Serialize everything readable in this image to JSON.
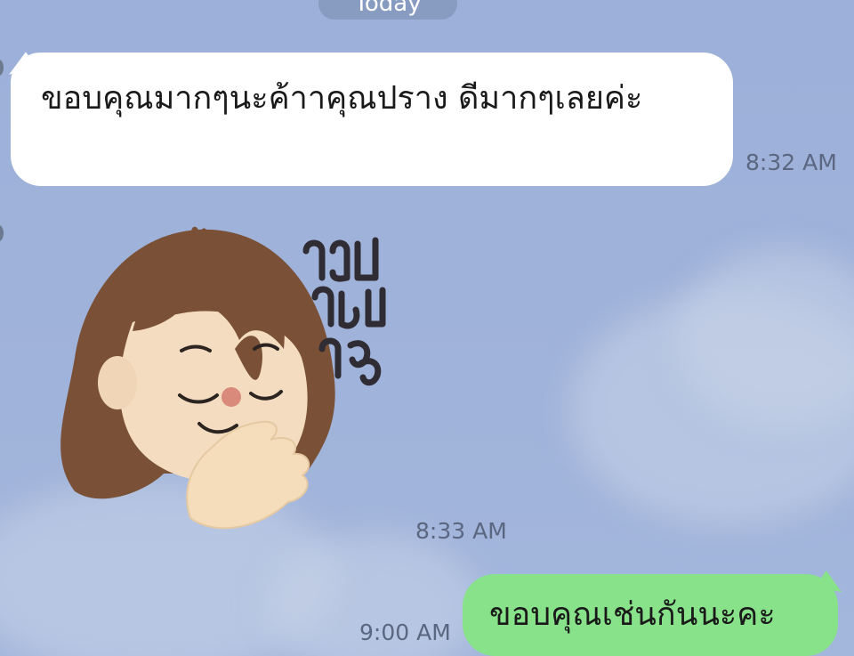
{
  "chat": {
    "date_separator": "Today",
    "messages": [
      {
        "direction": "incoming",
        "type": "text",
        "text": "ขอบคุณมากๆนะค้าาคุณปราง ดีมากๆเลยค่ะ",
        "time": "8:32 AM"
      },
      {
        "direction": "incoming",
        "type": "sticker",
        "sticker_text": "ขอบคุณค่ะ",
        "time": "8:33 AM"
      },
      {
        "direction": "outgoing",
        "type": "text",
        "text": "ขอบคุณเช่นกันนะคะ",
        "time": "9:00 AM"
      }
    ]
  },
  "colors": {
    "background": "#9fb1d8",
    "incoming_bubble": "#ffffff",
    "outgoing_bubble": "#88e28a",
    "timestamp": "#5b6780"
  },
  "icons": {
    "sticker": "girl-thank-you-sticker"
  }
}
